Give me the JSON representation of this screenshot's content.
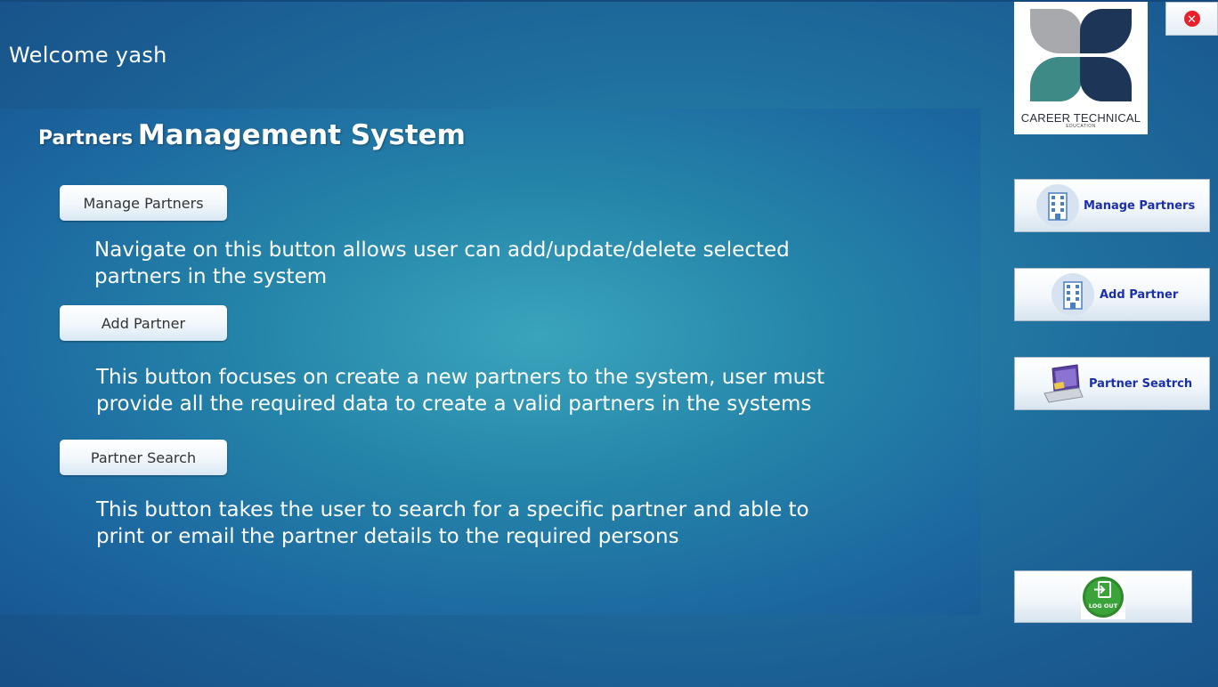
{
  "header": {
    "welcome": "Welcome yash"
  },
  "panel": {
    "title_small": "Partners",
    "title_big": "Management System",
    "sections": [
      {
        "button": "Manage Partners",
        "description_lines": [
          "Navigate on this button allows user can add/update/delete selected",
          "partners in the system"
        ]
      },
      {
        "button": "Add Partner",
        "description_lines": [
          "This button focuses on create a new partners to the system, user must",
          "provide all the required data to create a valid partners in the systems"
        ]
      },
      {
        "button": "Partner Search",
        "description_lines": [
          "This button takes the user to search for a specific partner and able to",
          "print or email the partner details to the required persons"
        ]
      }
    ]
  },
  "logo": {
    "brand": "CAREER TECHNICAL",
    "sub": "EDUCATION"
  },
  "sidebar": {
    "items": [
      {
        "label": "Manage Partners",
        "icon": "building-icon"
      },
      {
        "label": "Add Partner",
        "icon": "building-icon"
      },
      {
        "label": "Partner Seatrch",
        "icon": "laptop-icon"
      }
    ],
    "logout_label": "LOG OUT"
  },
  "colors": {
    "accent_text": "#1b2fa8",
    "close": "#e8202a",
    "logout": "#2d8a2d"
  }
}
